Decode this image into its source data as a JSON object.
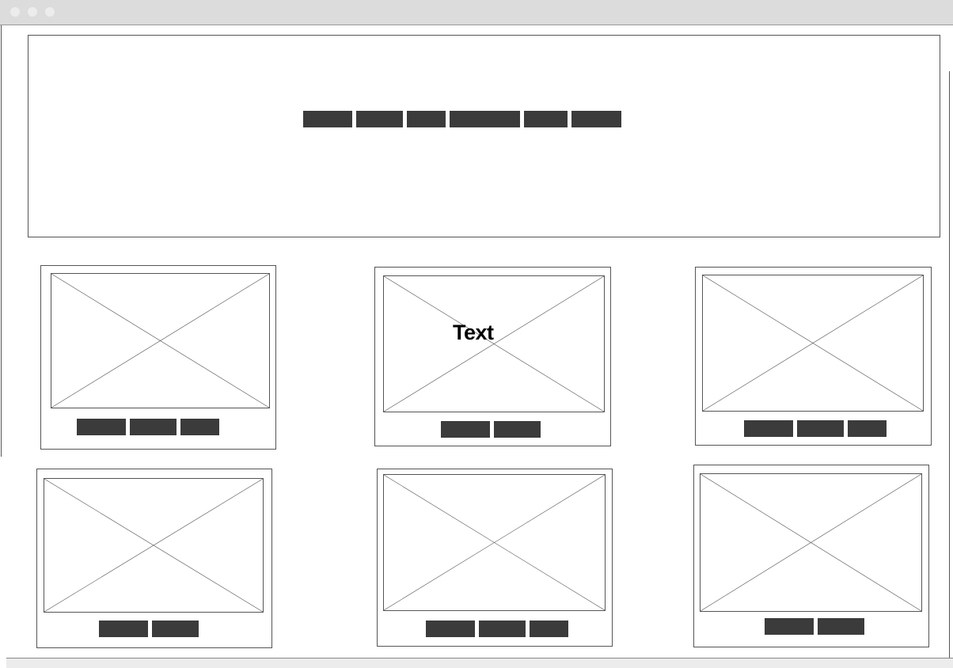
{
  "window": {
    "controls": [
      "close-icon",
      "minimize-icon",
      "maximize-icon"
    ]
  },
  "header": {
    "nav_item_count": 6
  },
  "cards": [
    {
      "text": "",
      "pill_count": 3
    },
    {
      "text": "Text",
      "pill_count": 2
    },
    {
      "text": "",
      "pill_count": 3
    },
    {
      "text": "",
      "pill_count": 2
    },
    {
      "text": "",
      "pill_count": 3
    },
    {
      "text": "",
      "pill_count": 2
    }
  ],
  "colors": {
    "titlebar": "#dcdcdc",
    "pill": "#3b3b3b",
    "border": "#555555"
  }
}
